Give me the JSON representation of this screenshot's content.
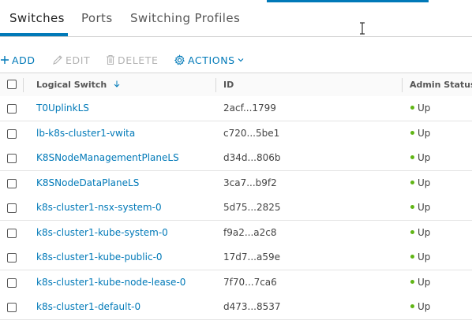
{
  "tabs": [
    {
      "label": "Switches",
      "active": true
    },
    {
      "label": "Ports",
      "active": false
    },
    {
      "label": "Switching Profiles",
      "active": false
    }
  ],
  "toolbar": {
    "add_label": "ADD",
    "edit_label": "EDIT",
    "delete_label": "DELETE",
    "actions_label": "ACTIONS"
  },
  "table": {
    "columns": [
      "Logical Switch",
      "ID",
      "Admin Status"
    ],
    "sort_column": "Logical Switch",
    "rows": [
      {
        "name": "T0UplinkLS",
        "id": "2acf...1799",
        "status": "Up"
      },
      {
        "name": "lb-k8s-cluster1-vwita",
        "id": "c720...5be1",
        "status": "Up"
      },
      {
        "name": "K8SNodeManagementPlaneLS",
        "id": "d34d...806b",
        "status": "Up"
      },
      {
        "name": "K8SNodeDataPlaneLS",
        "id": "3ca7...b9f2",
        "status": "Up"
      },
      {
        "name": "k8s-cluster1-nsx-system-0",
        "id": "5d75...2825",
        "status": "Up"
      },
      {
        "name": "k8s-cluster1-kube-system-0",
        "id": "f9a2...a2c8",
        "status": "Up"
      },
      {
        "name": "k8s-cluster1-kube-public-0",
        "id": "17d7...a59e",
        "status": "Up"
      },
      {
        "name": "k8s-cluster1-kube-node-lease-0",
        "id": "7f70...7ca6",
        "status": "Up"
      },
      {
        "name": "k8s-cluster1-default-0",
        "id": "d473...8537",
        "status": "Up"
      }
    ]
  },
  "colors": {
    "accent": "#0079b8",
    "status_up": "#60b515"
  }
}
